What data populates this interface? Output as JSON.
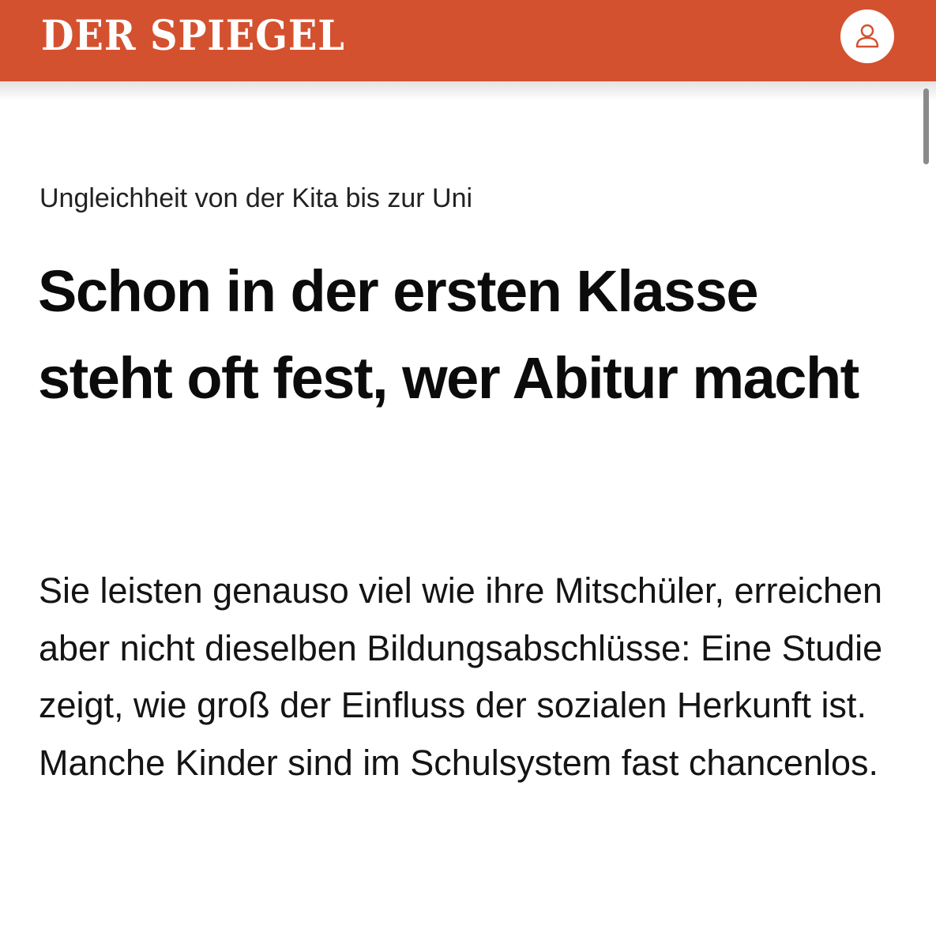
{
  "header": {
    "brand": "DER SPIEGEL",
    "brand_color": "#d4512f",
    "account_icon": "user-icon"
  },
  "article": {
    "kicker": "Ungleichheit von der Kita bis zur Uni",
    "headline": "Schon in der ersten Klasse steht oft fest, wer Abitur macht",
    "teaser": "Sie leisten genauso viel wie ihre Mitschüler, erreichen aber nicht dieselben Bildungsabschlüsse: Eine Studie zeigt, wie groß der Einfluss der sozialen Herkunft ist. Manche Kinder sind im Schulsystem fast chancenlos."
  }
}
